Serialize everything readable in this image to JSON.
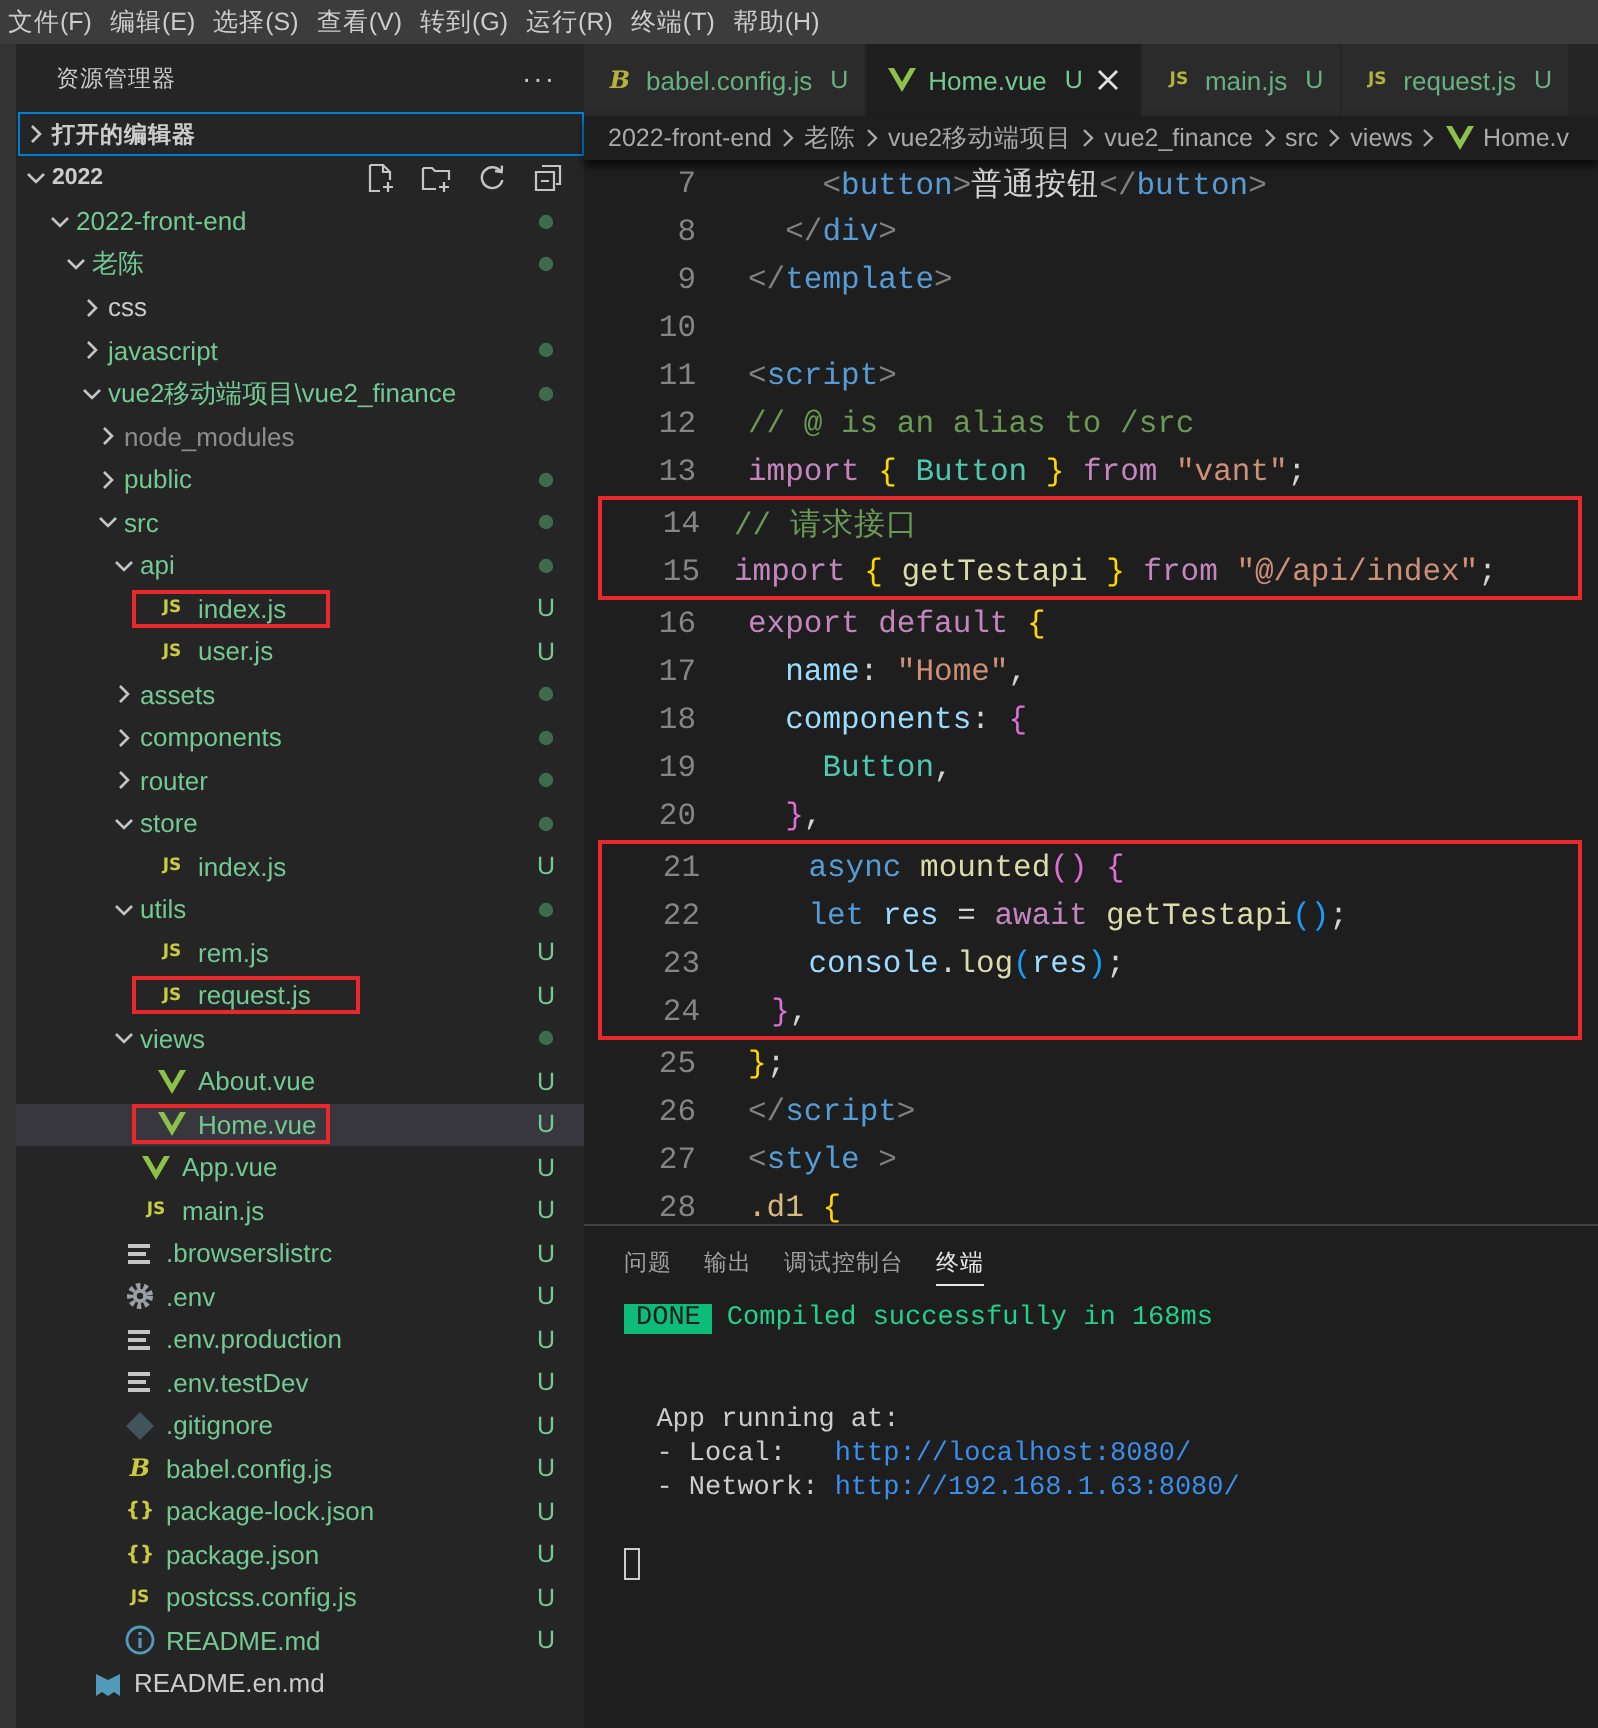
{
  "menu": [
    "文件(F)",
    "编辑(E)",
    "选择(S)",
    "查看(V)",
    "转到(G)",
    "运行(R)",
    "终端(T)",
    "帮助(H)"
  ],
  "explorer": {
    "title": "资源管理器",
    "more": "···",
    "open_editors": {
      "label": "打开的编辑器",
      "expanded": false,
      "focused": true
    },
    "root": {
      "label": "2022",
      "expanded": true
    },
    "tree": [
      {
        "name": "2022-front-end",
        "kind": "folder",
        "expanded": true,
        "untracked": true,
        "ignored": false,
        "changes": true,
        "children": [
          {
            "name": "老陈",
            "kind": "folder",
            "expanded": true,
            "untracked": true,
            "ignored": false,
            "changes": true,
            "children": [
              {
                "name": "css",
                "kind": "folder",
                "expanded": false,
                "untracked": false,
                "ignored": false,
                "changes": false
              },
              {
                "name": "javascript",
                "kind": "folder",
                "expanded": false,
                "untracked": true,
                "ignored": false,
                "changes": true
              },
              {
                "name": "vue2移动端项目\\vue2_finance",
                "kind": "folder",
                "expanded": true,
                "untracked": true,
                "ignored": false,
                "changes": true,
                "children": [
                  {
                    "name": "node_modules",
                    "kind": "folder",
                    "expanded": false,
                    "untracked": false,
                    "ignored": true,
                    "changes": false
                  },
                  {
                    "name": "public",
                    "kind": "folder",
                    "expanded": false,
                    "untracked": true,
                    "ignored": false,
                    "changes": true
                  },
                  {
                    "name": "src",
                    "kind": "folder",
                    "expanded": true,
                    "untracked": true,
                    "ignored": false,
                    "changes": true,
                    "children": [
                      {
                        "name": "api",
                        "kind": "folder",
                        "expanded": true,
                        "untracked": true,
                        "ignored": false,
                        "changes": true,
                        "children": [
                          {
                            "name": "index.js",
                            "kind": "js",
                            "icon_label": "JS",
                            "badge": "U",
                            "untracked": true,
                            "ignored": false,
                            "highlighted": true,
                            "selected": false
                          },
                          {
                            "name": "user.js",
                            "kind": "js",
                            "icon_label": "JS",
                            "badge": "U",
                            "untracked": true,
                            "ignored": false,
                            "highlighted": false,
                            "selected": false
                          }
                        ]
                      },
                      {
                        "name": "assets",
                        "kind": "folder",
                        "expanded": false,
                        "untracked": true,
                        "ignored": false,
                        "changes": true
                      },
                      {
                        "name": "components",
                        "kind": "folder",
                        "expanded": false,
                        "untracked": true,
                        "ignored": false,
                        "changes": true
                      },
                      {
                        "name": "router",
                        "kind": "folder",
                        "expanded": false,
                        "untracked": true,
                        "ignored": false,
                        "changes": true
                      },
                      {
                        "name": "store",
                        "kind": "folder",
                        "expanded": true,
                        "untracked": true,
                        "ignored": false,
                        "changes": true,
                        "children": [
                          {
                            "name": "index.js",
                            "kind": "js",
                            "icon_label": "JS",
                            "badge": "U",
                            "untracked": true,
                            "ignored": false,
                            "highlighted": false,
                            "selected": false
                          }
                        ]
                      },
                      {
                        "name": "utils",
                        "kind": "folder",
                        "expanded": true,
                        "untracked": true,
                        "ignored": false,
                        "changes": true,
                        "children": [
                          {
                            "name": "rem.js",
                            "kind": "js",
                            "icon_label": "JS",
                            "badge": "U",
                            "untracked": true,
                            "ignored": false,
                            "highlighted": false,
                            "selected": false
                          },
                          {
                            "name": "request.js",
                            "kind": "js",
                            "icon_label": "JS",
                            "badge": "U",
                            "untracked": true,
                            "ignored": false,
                            "highlighted": true,
                            "selected": false
                          }
                        ]
                      },
                      {
                        "name": "views",
                        "kind": "folder",
                        "expanded": true,
                        "untracked": true,
                        "ignored": false,
                        "changes": true,
                        "children": [
                          {
                            "name": "About.vue",
                            "kind": "vue",
                            "badge": "U",
                            "untracked": true,
                            "ignored": false,
                            "highlighted": false,
                            "selected": false
                          },
                          {
                            "name": "Home.vue",
                            "kind": "vue",
                            "badge": "U",
                            "untracked": true,
                            "ignored": false,
                            "highlighted": true,
                            "selected": true
                          }
                        ]
                      },
                      {
                        "name": "App.vue",
                        "kind": "vue",
                        "badge": "U",
                        "untracked": true,
                        "ignored": false,
                        "highlighted": false,
                        "selected": false
                      },
                      {
                        "name": "main.js",
                        "kind": "js",
                        "icon_label": "JS",
                        "badge": "U",
                        "untracked": true,
                        "ignored": false,
                        "highlighted": false,
                        "selected": false
                      }
                    ]
                  },
                  {
                    "name": ".browserslistrc",
                    "kind": "text",
                    "badge": "U",
                    "untracked": true,
                    "ignored": false,
                    "highlighted": false,
                    "selected": false
                  },
                  {
                    "name": ".env",
                    "kind": "gear",
                    "badge": "U",
                    "untracked": true,
                    "ignored": false,
                    "highlighted": false,
                    "selected": false
                  },
                  {
                    "name": ".env.production",
                    "kind": "text",
                    "badge": "U",
                    "untracked": true,
                    "ignored": false,
                    "highlighted": false,
                    "selected": false
                  },
                  {
                    "name": ".env.testDev",
                    "kind": "text",
                    "badge": "U",
                    "untracked": true,
                    "ignored": false,
                    "highlighted": false,
                    "selected": false
                  },
                  {
                    "name": ".gitignore",
                    "kind": "git",
                    "badge": "U",
                    "untracked": true,
                    "ignored": false,
                    "highlighted": false,
                    "selected": false
                  },
                  {
                    "name": "babel.config.js",
                    "kind": "babel",
                    "icon_label": "B",
                    "badge": "U",
                    "untracked": true,
                    "ignored": false,
                    "highlighted": false,
                    "selected": false
                  },
                  {
                    "name": "package-lock.json",
                    "kind": "json",
                    "icon_label": "{}",
                    "badge": "U",
                    "untracked": true,
                    "ignored": false,
                    "highlighted": false,
                    "selected": false
                  },
                  {
                    "name": "package.json",
                    "kind": "json",
                    "icon_label": "{}",
                    "badge": "U",
                    "untracked": true,
                    "ignored": false,
                    "highlighted": false,
                    "selected": false
                  },
                  {
                    "name": "postcss.config.js",
                    "kind": "js",
                    "icon_label": "JS",
                    "badge": "U",
                    "untracked": true,
                    "ignored": false,
                    "highlighted": false,
                    "selected": false
                  },
                  {
                    "name": "README.md",
                    "kind": "info",
                    "badge": "U",
                    "untracked": true,
                    "ignored": false,
                    "highlighted": false,
                    "selected": false
                  }
                ]
              }
            ]
          },
          {
            "name": "README.en.md",
            "kind": "markdown",
            "untracked": false,
            "ignored": false,
            "highlighted": false,
            "selected": false
          }
        ]
      }
    ]
  },
  "tabs": [
    {
      "label": "babel.config.js",
      "kind": "babel",
      "icon_label": "B",
      "badge": "U",
      "selected": false
    },
    {
      "label": "Home.vue",
      "kind": "vue",
      "badge": "U",
      "selected": true
    },
    {
      "label": "main.js",
      "kind": "js",
      "icon_label": "JS",
      "badge": "U",
      "selected": false
    },
    {
      "label": "request.js",
      "kind": "js",
      "icon_label": "JS",
      "badge": "U",
      "selected": false
    }
  ],
  "breadcrumb": [
    {
      "label": "2022-front-end",
      "kind": "folder"
    },
    {
      "label": "老陈",
      "kind": "folder"
    },
    {
      "label": "vue2移动端项目",
      "kind": "folder"
    },
    {
      "label": "vue2_finance",
      "kind": "folder"
    },
    {
      "label": "src",
      "kind": "folder"
    },
    {
      "label": "views",
      "kind": "folder"
    },
    {
      "label": "Home.v",
      "kind": "vue"
    }
  ],
  "code": [
    {
      "n": "7",
      "box": false,
      "tokens": [
        {
          "t": "    <",
          "kind": "punct"
        },
        {
          "t": "button",
          "kind": "tag"
        },
        {
          "t": ">",
          "kind": "punct"
        },
        {
          "t": "普通按钮",
          "kind": "text"
        },
        {
          "t": "</",
          "kind": "punct"
        },
        {
          "t": "button",
          "kind": "tag"
        },
        {
          "t": ">",
          "kind": "punct"
        }
      ]
    },
    {
      "n": "8",
      "box": false,
      "tokens": [
        {
          "t": "  </",
          "kind": "punct"
        },
        {
          "t": "div",
          "kind": "tag"
        },
        {
          "t": ">",
          "kind": "punct"
        }
      ]
    },
    {
      "n": "9",
      "box": false,
      "tokens": [
        {
          "t": "</",
          "kind": "punct"
        },
        {
          "t": "template",
          "kind": "tag"
        },
        {
          "t": ">",
          "kind": "punct"
        }
      ]
    },
    {
      "n": "10",
      "box": false
    },
    {
      "n": "11",
      "box": false,
      "tokens": [
        {
          "t": "<",
          "kind": "punct"
        },
        {
          "t": "script",
          "kind": "tag"
        },
        {
          "t": ">",
          "kind": "punct"
        }
      ]
    },
    {
      "n": "12",
      "box": false,
      "tokens": [
        {
          "t": "// @ is an alias to /src",
          "kind": "comment"
        }
      ]
    },
    {
      "n": "13",
      "box": false,
      "tokens": [
        {
          "t": "import ",
          "kind": "keyword"
        },
        {
          "t": "{ ",
          "kind": "brace1"
        },
        {
          "t": "Button ",
          "kind": "type"
        },
        {
          "t": "} ",
          "kind": "brace1"
        },
        {
          "t": "from ",
          "kind": "keyword"
        },
        {
          "t": "\"vant\"",
          "kind": "string"
        },
        {
          "t": ";",
          "kind": "text"
        }
      ]
    },
    {
      "n": "14",
      "box": true,
      "tokens": [
        {
          "t": "// 请求接口",
          "kind": "comment"
        }
      ]
    },
    {
      "n": "15",
      "box": true,
      "tokens": [
        {
          "t": "import ",
          "kind": "keyword"
        },
        {
          "t": "{ ",
          "kind": "brace1"
        },
        {
          "t": "getTestapi ",
          "kind": "function"
        },
        {
          "t": "} ",
          "kind": "brace1"
        },
        {
          "t": "from ",
          "kind": "keyword"
        },
        {
          "t": "\"@/api/index\"",
          "kind": "string"
        },
        {
          "t": ";",
          "kind": "text"
        }
      ]
    },
    {
      "n": "16",
      "box": false,
      "tokens": [
        {
          "t": "export default ",
          "kind": "keyword"
        },
        {
          "t": "{",
          "kind": "brace1"
        }
      ]
    },
    {
      "n": "17",
      "box": false,
      "tokens": [
        {
          "t": "  name",
          "kind": "variable"
        },
        {
          "t": ": ",
          "kind": "text"
        },
        {
          "t": "\"Home\"",
          "kind": "string"
        },
        {
          "t": ",",
          "kind": "text"
        }
      ]
    },
    {
      "n": "18",
      "box": false,
      "tokens": [
        {
          "t": "  components",
          "kind": "variable"
        },
        {
          "t": ": ",
          "kind": "text"
        },
        {
          "t": "{",
          "kind": "brace2"
        }
      ]
    },
    {
      "n": "19",
      "box": false,
      "tokens": [
        {
          "t": "    Button",
          "kind": "type"
        },
        {
          "t": ",",
          "kind": "text"
        }
      ]
    },
    {
      "n": "20",
      "box": false,
      "tokens": [
        {
          "t": "  }",
          "kind": "brace2"
        },
        {
          "t": ",",
          "kind": "text"
        }
      ]
    },
    {
      "n": "21",
      "box": true,
      "tokens": [
        {
          "t": "    async ",
          "kind": "storage"
        },
        {
          "t": "mounted",
          "kind": "function"
        },
        {
          "t": "() {",
          "kind": "brace2"
        }
      ]
    },
    {
      "n": "22",
      "box": true,
      "tokens": [
        {
          "t": "    let ",
          "kind": "storage"
        },
        {
          "t": "res",
          "kind": "variable"
        },
        {
          "t": " = ",
          "kind": "text"
        },
        {
          "t": "await ",
          "kind": "keyword"
        },
        {
          "t": "getTestapi",
          "kind": "function"
        },
        {
          "t": "()",
          "kind": "brace3"
        },
        {
          "t": ";",
          "kind": "text"
        }
      ]
    },
    {
      "n": "23",
      "box": true,
      "tokens": [
        {
          "t": "    console",
          "kind": "variable"
        },
        {
          "t": ".",
          "kind": "text"
        },
        {
          "t": "log",
          "kind": "function"
        },
        {
          "t": "(",
          "kind": "brace3"
        },
        {
          "t": "res",
          "kind": "variable"
        },
        {
          "t": ")",
          "kind": "brace3"
        },
        {
          "t": ";",
          "kind": "text"
        }
      ]
    },
    {
      "n": "24",
      "box": true,
      "tokens": [
        {
          "t": "  }",
          "kind": "brace2"
        },
        {
          "t": ",",
          "kind": "text"
        }
      ]
    },
    {
      "n": "25",
      "box": false,
      "tokens": [
        {
          "t": "}",
          "kind": "brace1"
        },
        {
          "t": ";",
          "kind": "text"
        }
      ]
    },
    {
      "n": "26",
      "box": false,
      "tokens": [
        {
          "t": "</",
          "kind": "punct"
        },
        {
          "t": "script",
          "kind": "tag"
        },
        {
          "t": ">",
          "kind": "punct"
        }
      ]
    },
    {
      "n": "27",
      "box": false,
      "tokens": [
        {
          "t": "<",
          "kind": "punct"
        },
        {
          "t": "style",
          "kind": "tag"
        },
        {
          "t": " >",
          "kind": "punct"
        }
      ]
    },
    {
      "n": "28",
      "box": false,
      "tokens": [
        {
          "t": ".d1 ",
          "kind": "selector"
        },
        {
          "t": "{",
          "kind": "brace1"
        }
      ]
    }
  ],
  "panel": {
    "tabs": [
      {
        "label": "问题",
        "selected": false
      },
      {
        "label": "输出",
        "selected": false
      },
      {
        "label": "调试控制台",
        "selected": false
      },
      {
        "label": "终端",
        "selected": true
      }
    ],
    "terminal": [
      {
        "kind": "status",
        "badge": "DONE",
        "text": "Compiled successfully in 168ms"
      },
      {
        "kind": "blank"
      },
      {
        "kind": "blank"
      },
      {
        "kind": "plain",
        "text": "  App running at:"
      },
      {
        "kind": "link",
        "text": "  - Local:   ",
        "link": "http://localhost:8080/"
      },
      {
        "kind": "link",
        "text": "  - Network: ",
        "link": "http://192.168.1.63:8080/"
      },
      {
        "kind": "blank"
      },
      {
        "kind": "cursor"
      }
    ]
  }
}
